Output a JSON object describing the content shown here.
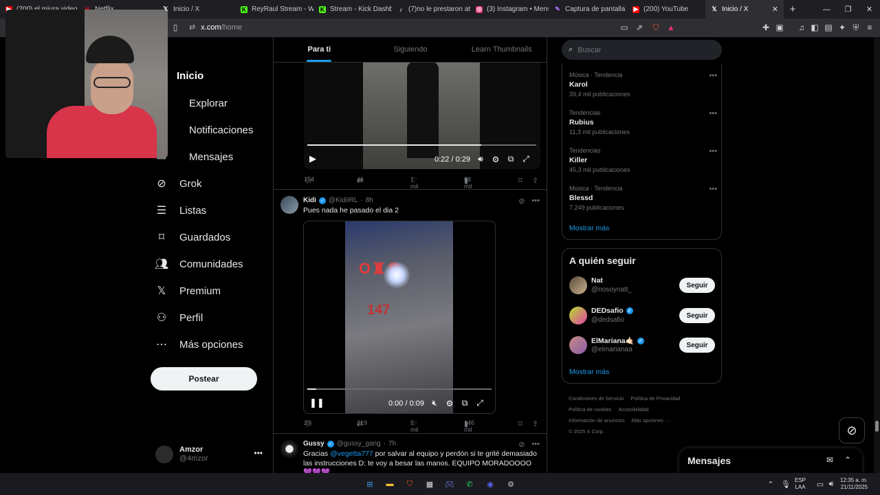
{
  "browser": {
    "tabs": [
      {
        "label": "(200) el miura video",
        "icon": "youtube-icon",
        "color": "#ff0000"
      },
      {
        "label": "Netflix",
        "icon": "netflix-icon",
        "color": "#e50914"
      },
      {
        "label": "Inicio / X",
        "icon": "x-icon",
        "color": "#ffffff"
      },
      {
        "label": "ReyRaul Stream - Wat",
        "icon": "kick-icon",
        "color": "#53fc18"
      },
      {
        "label": "Stream - Kick Dashbo",
        "icon": "kick-icon",
        "color": "#53fc18"
      },
      {
        "label": "(7)no le prestaron aten",
        "icon": "tiktok-icon",
        "color": "#ffffff"
      },
      {
        "label": "(3) Instagram • Mensa",
        "icon": "instagram-icon",
        "color": "#e1306c"
      },
      {
        "label": "Captura de pantalla pc",
        "icon": "pen-icon",
        "color": "#a970ff"
      },
      {
        "label": "(200) YouTube",
        "icon": "youtube-icon",
        "color": "#ff0000"
      },
      {
        "label": "Inicio / X",
        "icon": "x-icon",
        "color": "#ffffff",
        "active": true
      }
    ],
    "url_host": "x.com",
    "url_path": "/home"
  },
  "nav": {
    "items": [
      {
        "label": "Inicio",
        "icon": "home-icon"
      },
      {
        "label": "Explorar",
        "icon": "search-icon"
      },
      {
        "label": "Notificaciones",
        "icon": "bell-icon"
      },
      {
        "label": "Mensajes",
        "icon": "mail-icon"
      },
      {
        "label": "Grok",
        "icon": "grok-icon"
      },
      {
        "label": "Listas",
        "icon": "list-icon"
      },
      {
        "label": "Guardados",
        "icon": "bookmark-icon"
      },
      {
        "label": "Comunidades",
        "icon": "people-icon"
      },
      {
        "label": "Premium",
        "icon": "x-icon"
      },
      {
        "label": "Perfil",
        "icon": "person-icon"
      },
      {
        "label": "Más opciones",
        "icon": "more-circle-icon"
      }
    ],
    "post_button": "Postear",
    "account": {
      "name": "Amzor",
      "handle": "@4mzor"
    }
  },
  "timeline": {
    "tabs": [
      "Para ti",
      "Siguiendo",
      "Learn Thumbnails"
    ],
    "active_tab": 0,
    "post1": {
      "video_time": "0:22 / 0:29",
      "video_progress": 0.76,
      "replies": "154",
      "reposts": "46",
      "likes": "1 mil",
      "views": "88 mil"
    },
    "post2": {
      "name": "Kidi",
      "handle": "@KidiIRL",
      "time": "8h",
      "text": "Pues nada he pasado el dia 2",
      "video_time": "0:00 / 0:09",
      "video_progress": 0.05,
      "replies": "29",
      "reposts": "219",
      "likes": "5 mil",
      "views": "146 mil"
    },
    "post3": {
      "name": "Gussy",
      "handle": "@gussy_gang",
      "time": "7h",
      "text_before": "Gracias ",
      "mention": "@vegetta777",
      "text_after": " por salvar al equipo y perdón si te grité demasiado las instrucciones D: te voy a besar las manos. EQUIPO MORADOOOO 💜💜💜"
    }
  },
  "sidebar": {
    "search_placeholder": "Buscar",
    "trends": [
      {
        "category": "Música · Tendencia",
        "name": "Karol",
        "count": "39,4 mil publicaciones"
      },
      {
        "category": "Tendencias",
        "name": "Rubius",
        "count": "11,3 mil publicaciones"
      },
      {
        "category": "Tendencias",
        "name": "Killer",
        "count": "45,3 mil publicaciones"
      },
      {
        "category": "Música · Tendencia",
        "name": "Blessd",
        "count": "7.249 publicaciones"
      }
    ],
    "trends_show_more": "Mostrar más",
    "who_to_follow_title": "A quién seguir",
    "who_to_follow": [
      {
        "name": "Nat",
        "handle": "@nosoynatt_",
        "verified": false,
        "button": "Seguir"
      },
      {
        "name": "DEDsafio",
        "handle": "@dedsafio",
        "verified": true,
        "button": "Seguir"
      },
      {
        "name": "ElMariana🤙🏻",
        "handle": "@elmarianaa",
        "verified": true,
        "button": "Seguir"
      }
    ],
    "who_show_more": "Mostrar más",
    "footer": [
      "Condiciones de Servicio",
      "Política de Privacidad",
      "Política de cookies",
      "Accesibilidad",
      "Información de anuncios",
      "Más opciones ···",
      "© 2025 X Corp."
    ]
  },
  "messages_drawer": {
    "title": "Mensajes"
  },
  "taskbar": {
    "lang_top": "ESP",
    "lang_bottom": "LAA",
    "time": "12:35 a. m.",
    "date": "21/11/2025"
  }
}
